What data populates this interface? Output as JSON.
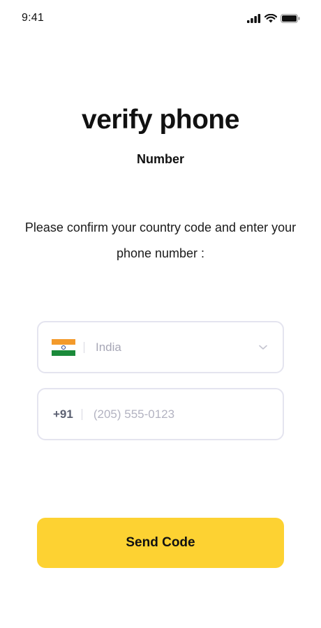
{
  "status_bar": {
    "time": "9:41",
    "icons": [
      "signal-icon",
      "wifi-icon",
      "battery-icon"
    ]
  },
  "header": {
    "title": "verify phone",
    "subtitle": "Number"
  },
  "instructions": "Please confirm your country code and enter your phone number :",
  "country_field": {
    "flag": "india-flag-icon",
    "value": "India",
    "dropdown_icon": "chevron-down-icon"
  },
  "phone_field": {
    "dial_code": "+91",
    "placeholder": "(205) 555-0123",
    "value": ""
  },
  "send_button": {
    "label": "Send Code"
  },
  "colors": {
    "accent": "#fdd232",
    "field_border": "#e4e4ef",
    "placeholder": "#b3b3c1",
    "text": "#111111"
  }
}
